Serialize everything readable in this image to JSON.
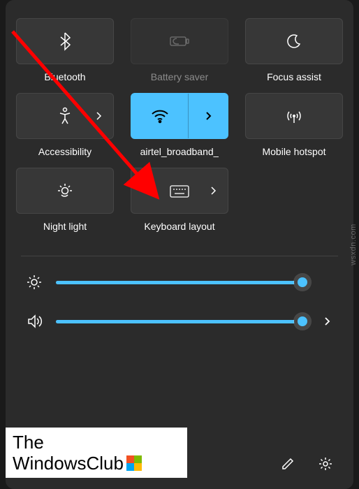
{
  "tiles": {
    "bluetooth": {
      "label": "Bluetooth"
    },
    "battery_saver": {
      "label": "Battery saver"
    },
    "focus_assist": {
      "label": "Focus assist"
    },
    "accessibility": {
      "label": "Accessibility"
    },
    "wifi": {
      "label": "airtel_broadband_"
    },
    "mobile_hotspot": {
      "label": "Mobile hotspot"
    },
    "night_light": {
      "label": "Night light"
    },
    "keyboard_layout": {
      "label": "Keyboard layout"
    }
  },
  "sliders": {
    "brightness": {
      "value": 98
    },
    "volume": {
      "value": 98
    }
  },
  "watermark": {
    "line1": "The",
    "line2": "WindowsClub",
    "side": "wsxdn.com"
  },
  "colors": {
    "accent": "#4cc2ff"
  }
}
